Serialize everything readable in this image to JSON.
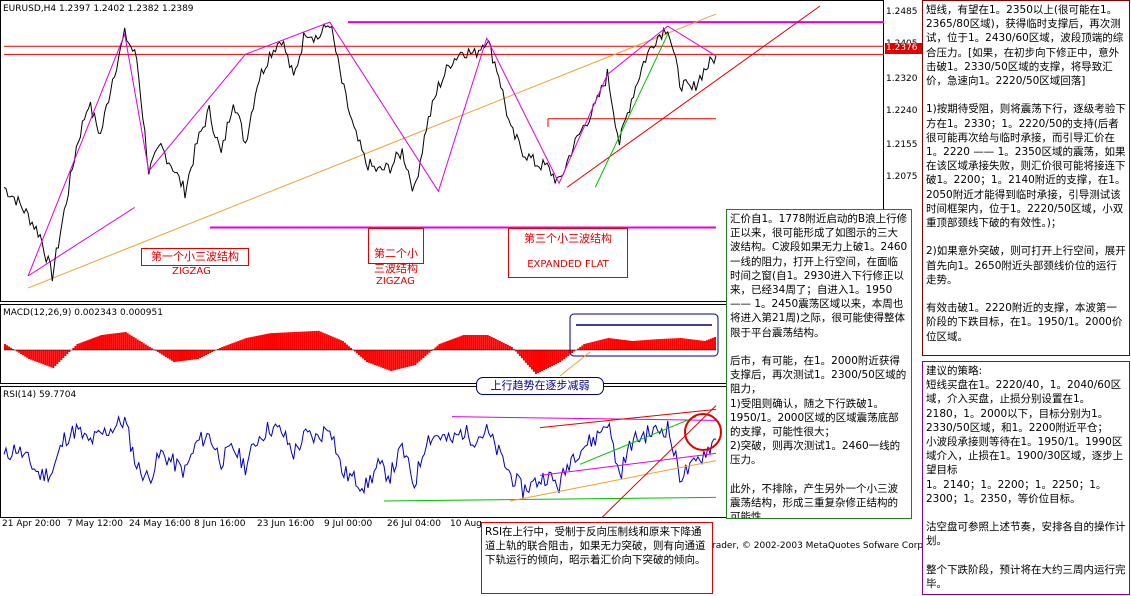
{
  "chart_window": {
    "symbol_header": "EURUSD,H4  1.2397 1.2402 1.2382 1.2389",
    "current_price": "1.2376",
    "copyright": "rader, © 2002-2003 MetaQuotes Sofware Corp"
  },
  "colors": {
    "price_line": "#000000",
    "trend_magenta": "#e000e0",
    "support_red": "#e00000",
    "channel_orange": "#f0a030",
    "green_line": "#00c000",
    "rsi_line": "#0000c0",
    "macd_hist": "#ff0000",
    "note_green_border": "#208020",
    "note_maroon_border": "#800000",
    "note_purple_border": "#8000a0",
    "annotation_blue": "#000080"
  },
  "wave_labels": {
    "first": "第一个小三波结构",
    "first_sub": "ZIGZAG",
    "second": "第二个小\n三波结构",
    "second_sub": "ZIGZAG",
    "third": "第三个小三波结构",
    "third_sub": "EXPANDED FLAT"
  },
  "indicator_titles": {
    "macd": "MACD(12,26,9)  0.002343  0.000951",
    "rsi": "RSI(14)  59.7704"
  },
  "annotations": {
    "macd_note": "上行趋势在逐步减弱"
  },
  "notes": {
    "top_right": "短线，有望在1。2350以上(很可能在1。2365/80区域)，获得临时支撑后，再次测试，位于1。2430/60区域，波段顶端的综合压力。[如果，在初步向下修正中，意外击破1。2330/50区域的支撑，将导致汇价，急速向1。2220/50区域回落]\n\n1)按期待受阻，则将震荡下行，逐级考验下方在1。2330；1。2220/50的支持(后者很可能再次给与临时承接，而引导汇价在1。2220 —— 1。2350区域的震荡，如果在该区域承接失败，则汇价很可能将接连下破1。2200；1。2140附近的支撑，在1。2050附近才能得到临时承接，引导测试该时间框架内，位于1。2220/50区域，小双重顶部颈线下破的有效性。)；\n\n2)如果意外突破，则可打开上行空间，展开首先向1。2650附近头部颈线价位的运行走势。\n\n有效击破1。2220附近的支撑，本波第一阶段的下跌目标，在1。1950/1。2000价位区域。",
    "middle": "汇价自1。1778附近启动的B浪上行修正以来，很可能形成了如图示的三大波结构。C波段如果无力上破1。2460一线的阻力，打开上行空间，在面临时间之窗(自1。2930进入下行修正以来，已经34周了；自进入1。1950 —— 1。2450震荡区域以来，本周也将进入第21周)之际，很可能使得整体限于平台震荡结构。\n\n后市，有可能，在1。2000附近获得支撑后，再次测试1。2300/50区域的阻力，\n1)受阻则确认，随之下行跌破1。1950/1。2000区域的区域震荡底部的支撑，可能性很大；\n2)突破，则再次测试1。2460一线的压力。\n\n此外，不排除，产生另外一个小三波震荡结构，形成三重复杂修正结构的可能性。",
    "bottom_right": "建议的策略:\n短线买盘在1。2220/40，1。2040/60区域，介入买盘，止损分别设置在1。2180，1。2000以下，目标分别为1。2330/50区域，和1。2200附近平仓；\n小波段承接则等待在1。1950/1。1990区域介入，止损在1。1900/30区域，逐步上望目标\n1。2140；1。2200；1。2250；1。2300；1。2350，等价位目标。\n\n沽空盘可参照上述节奏，安排各自的操作计划。\n\n整个下跌阶段，预计将在大约三周内运行完毕。",
    "bottom_red": "RSI在上行中，受制于反向压制线和原来下降通道上轨的联合阻击，如果无力突破，则有向通道下轨运行的倾向，昭示着汇价向下突破的倾向。"
  },
  "chart_data": {
    "type": "line",
    "series": [
      {
        "name": "EURUSD,H4",
        "chart": "price",
        "x": [
          0,
          12,
          24,
          36,
          48,
          60,
          72,
          84,
          96,
          108,
          120,
          132,
          144,
          156,
          168,
          180,
          192,
          204,
          216,
          228,
          240,
          252,
          264,
          276,
          288,
          300,
          312,
          324,
          336,
          348,
          360,
          372,
          384,
          396,
          408,
          420,
          432,
          444,
          456,
          468,
          480,
          492,
          504,
          516,
          528,
          540,
          552,
          564,
          576,
          588,
          600,
          612,
          624,
          636,
          648,
          660,
          672,
          684,
          696,
          708
        ],
        "values": [
          1.205,
          1.202,
          1.198,
          1.193,
          1.183,
          1.199,
          1.215,
          1.226,
          1.218,
          1.232,
          1.243,
          1.237,
          1.209,
          1.215,
          1.21,
          1.204,
          1.216,
          1.224,
          1.213,
          1.227,
          1.216,
          1.231,
          1.238,
          1.242,
          1.232,
          1.244,
          1.242,
          1.246,
          1.231,
          1.219,
          1.211,
          1.209,
          1.21,
          1.214,
          1.204,
          1.22,
          1.23,
          1.236,
          1.239,
          1.238,
          1.242,
          1.233,
          1.219,
          1.214,
          1.211,
          1.21,
          1.206,
          1.214,
          1.22,
          1.225,
          1.233,
          1.216,
          1.227,
          1.236,
          1.242,
          1.245,
          1.231,
          1.229,
          1.234,
          1.2376
        ]
      },
      {
        "name": "MACD(12,26,9)",
        "chart": "macd",
        "x": [
          0,
          24,
          48,
          72,
          96,
          120,
          144,
          168,
          192,
          216,
          240,
          264,
          288,
          312,
          336,
          360,
          384,
          408,
          432,
          456,
          480,
          504,
          528,
          552,
          576,
          600,
          624,
          648,
          672,
          696,
          708
        ],
        "values": [
          0.001,
          -0.0015,
          -0.003,
          0.001,
          0.0025,
          0.003,
          0.0005,
          -0.002,
          -0.0015,
          0.0005,
          0.002,
          0.0028,
          0.003,
          0.0032,
          0.0015,
          -0.002,
          -0.0035,
          -0.0025,
          0.001,
          0.0025,
          0.0025,
          0.0005,
          -0.004,
          -0.002,
          0.001,
          0.002,
          0.0015,
          0.0018,
          0.002,
          0.0015,
          0.0023
        ]
      },
      {
        "name": "RSI(14)",
        "chart": "rsi",
        "x": [
          0,
          12,
          24,
          36,
          48,
          60,
          72,
          84,
          96,
          108,
          120,
          132,
          144,
          156,
          168,
          180,
          192,
          204,
          216,
          228,
          240,
          252,
          264,
          276,
          288,
          300,
          312,
          324,
          336,
          348,
          360,
          372,
          384,
          396,
          408,
          420,
          432,
          444,
          456,
          468,
          480,
          492,
          504,
          516,
          528,
          540,
          552,
          564,
          576,
          588,
          600,
          612,
          624,
          636,
          648,
          660,
          672,
          684,
          696,
          708
        ],
        "values": [
          50,
          55,
          48,
          40,
          42,
          60,
          65,
          58,
          62,
          66,
          70,
          45,
          38,
          52,
          47,
          42,
          58,
          62,
          48,
          55,
          45,
          60,
          66,
          64,
          52,
          62,
          60,
          68,
          42,
          38,
          34,
          45,
          40,
          55,
          35,
          60,
          62,
          58,
          64,
          60,
          64,
          52,
          40,
          32,
          36,
          40,
          34,
          50,
          56,
          60,
          70,
          40,
          58,
          62,
          64,
          66,
          40,
          44,
          52,
          59.77
        ]
      }
    ],
    "price_axis": {
      "ticks": [
        "1.2485",
        "1.2405",
        "1.2320",
        "1.2240",
        "1.2155",
        "1.2075"
      ],
      "min": 1.178,
      "max": 1.25
    },
    "macd_axis": {
      "min": -0.005,
      "max": 0.005
    },
    "rsi_axis": {
      "min": 20,
      "max": 80
    },
    "x_ticks": [
      "21 Apr 20:00",
      "7 May 12:00",
      "24 May 16:00",
      "8 Jun 16:00",
      "23 Jun 16:00",
      "9 Jul 00:00",
      "26 Jul 04:00",
      "10 Aug"
    ],
    "levels": {
      "top_resistance": 1.246,
      "neck_support": 1.195,
      "mid_support": 1.222
    },
    "grid": false,
    "legend": "none"
  }
}
